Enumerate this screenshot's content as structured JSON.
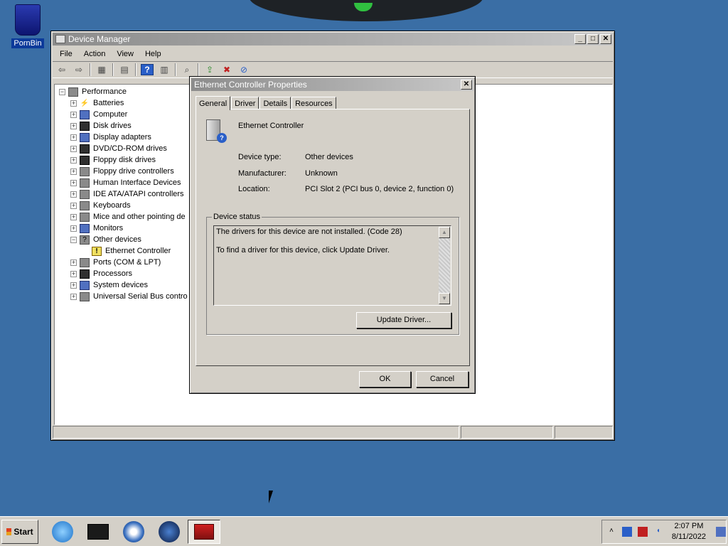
{
  "desktop": {
    "icons": [
      {
        "label": "PornBin",
        "icon": "recycle-bin-icon"
      }
    ]
  },
  "device_manager": {
    "title": "Device Manager",
    "menu": [
      "File",
      "Action",
      "View",
      "Help"
    ],
    "toolbar_icons": [
      "back-icon",
      "forward-icon",
      "up-icon",
      "properties-icon",
      "help-icon",
      "view-icon",
      "scan-icon",
      "update-driver-icon",
      "uninstall-icon",
      "disable-icon"
    ],
    "tree": {
      "root": "Performance",
      "items": [
        {
          "label": "Batteries",
          "icon": "battery-icon",
          "expanded": false
        },
        {
          "label": "Computer",
          "icon": "computer-icon",
          "expanded": false
        },
        {
          "label": "Disk drives",
          "icon": "disk-drive-icon",
          "expanded": false
        },
        {
          "label": "Display adapters",
          "icon": "display-adapter-icon",
          "expanded": false
        },
        {
          "label": "DVD/CD-ROM drives",
          "icon": "dvd-drive-icon",
          "expanded": false
        },
        {
          "label": "Floppy disk drives",
          "icon": "floppy-drive-icon",
          "expanded": false
        },
        {
          "label": "Floppy drive controllers",
          "icon": "floppy-controller-icon",
          "expanded": false
        },
        {
          "label": "Human Interface Devices",
          "icon": "hid-icon",
          "expanded": false
        },
        {
          "label": "IDE ATA/ATAPI controllers",
          "icon": "ide-controller-icon",
          "expanded": false
        },
        {
          "label": "Keyboards",
          "icon": "keyboard-icon",
          "expanded": false
        },
        {
          "label": "Mice and other pointing de",
          "icon": "mouse-icon",
          "expanded": false
        },
        {
          "label": "Monitors",
          "icon": "monitor-icon",
          "expanded": false
        },
        {
          "label": "Other devices",
          "icon": "unknown-device-icon",
          "expanded": true
        },
        {
          "label": "Ethernet Controller",
          "icon": "warning-device-icon",
          "child": true
        },
        {
          "label": "Ports (COM & LPT)",
          "icon": "port-icon",
          "expanded": false
        },
        {
          "label": "Processors",
          "icon": "processor-icon",
          "expanded": false
        },
        {
          "label": "System devices",
          "icon": "system-device-icon",
          "expanded": false
        },
        {
          "label": "Universal Serial Bus contro",
          "icon": "usb-icon",
          "expanded": false
        }
      ]
    }
  },
  "properties_dialog": {
    "title": "Ethernet Controller Properties",
    "tabs": [
      "General",
      "Driver",
      "Details",
      "Resources"
    ],
    "active_tab": "General",
    "device_name": "Ethernet Controller",
    "properties": [
      {
        "key": "Device type:",
        "value": "Other devices"
      },
      {
        "key": "Manufacturer:",
        "value": "Unknown"
      },
      {
        "key": "Location:",
        "value": "PCI Slot 2 (PCI bus 0, device 2, function 0)"
      }
    ],
    "status_group_label": "Device status",
    "status_lines": [
      "The drivers for this device are not installed. (Code 28)",
      "To find a driver for this device, click Update Driver."
    ],
    "update_driver_label": "Update Driver...",
    "ok_label": "OK",
    "cancel_label": "Cancel"
  },
  "taskbar": {
    "start_label": "Start",
    "quick_launch": [
      "internet-explorer-icon",
      "terminal-icon",
      "media-player-icon",
      "network-globe-icon",
      "device-manager-toolbox-icon"
    ],
    "tray_icons": [
      "show-hidden-chevron-icon",
      "network-icon",
      "battery-tray-icon",
      "volume-icon"
    ],
    "time": "2:07 PM",
    "date": "8/11/2022",
    "desktop_button_icon": "show-desktop-icon"
  }
}
